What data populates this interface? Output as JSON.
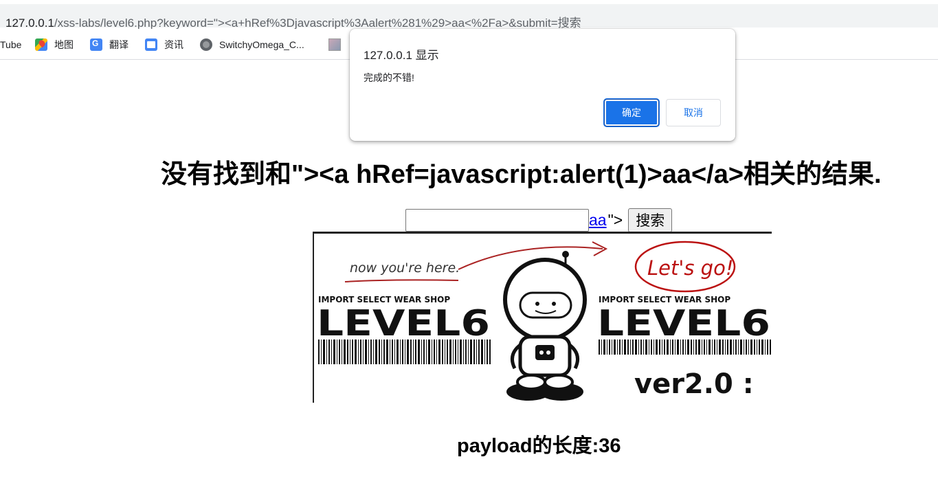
{
  "browser": {
    "url_host": "127.0.0.1",
    "url_path": "/xss-labs/level6.php?keyword=\"><a+hRef%3Djavascript%3Aalert%281%29>aa<%2Fa>&submit=搜索",
    "bookmarks": [
      {
        "label": "Tube",
        "icon": "youtube-icon"
      },
      {
        "label": "地图",
        "icon": "maps-icon"
      },
      {
        "label": "翻译",
        "icon": "translate-icon"
      },
      {
        "label": "资讯",
        "icon": "news-icon"
      },
      {
        "label": "SwitchyOmega_C...",
        "icon": "globe-icon"
      },
      {
        "label": "",
        "icon": "image-icon"
      }
    ]
  },
  "dialog": {
    "title": "127.0.0.1 显示",
    "message": "完成的不错!",
    "ok_label": "确定",
    "cancel_label": "取消"
  },
  "page": {
    "heading": "没有找到和\"><a hRef=javascript:alert(1)>aa</a>相关的结果.",
    "search_value": "",
    "injected_link_text": "aa",
    "trailing_text": "\">",
    "submit_label": "搜索",
    "payload_length_text": "payload的长度:36"
  },
  "banner": {
    "annotation": "now you're here.",
    "callout": "Let's go!",
    "shop_text": "IMPORT SELECT WEAR SHOP",
    "level_text": "LEVEL6",
    "version_text": "ver2.0 :"
  }
}
